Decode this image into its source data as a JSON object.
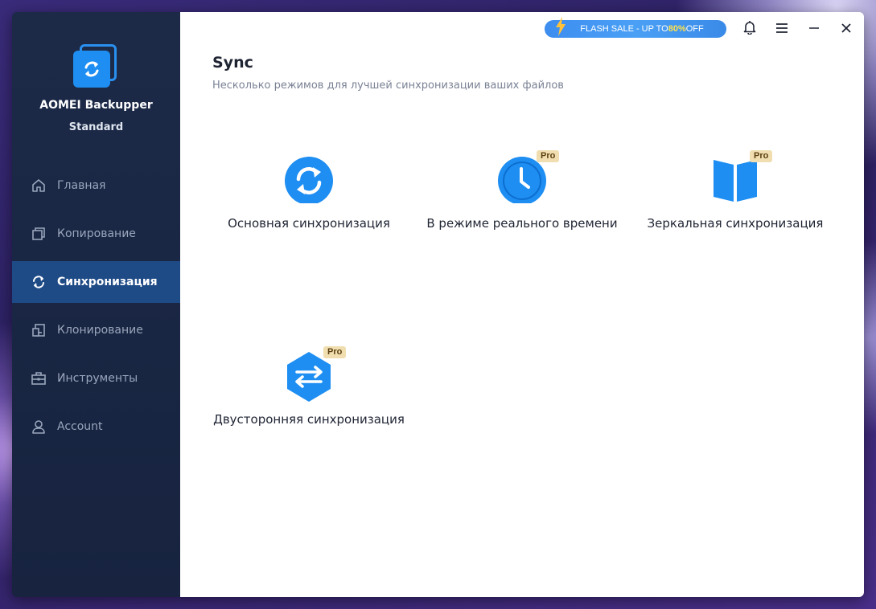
{
  "app": {
    "name": "AOMEI Backupper",
    "edition": "Standard"
  },
  "sidebar": {
    "items": [
      {
        "label": "Главная",
        "icon": "home-icon"
      },
      {
        "label": "Копирование",
        "icon": "copy-icon"
      },
      {
        "label": "Синхронизация",
        "icon": "sync-icon",
        "active": true
      },
      {
        "label": "Клонирование",
        "icon": "clone-icon"
      },
      {
        "label": "Инструменты",
        "icon": "toolbox-icon"
      },
      {
        "label": "Account",
        "icon": "user-icon"
      }
    ]
  },
  "topbar": {
    "flash_text": "FLASH SALE - UP TO ",
    "flash_pct": "80%",
    "flash_tail": " OFF"
  },
  "main": {
    "title": "Sync",
    "subtitle": "Несколько режимов для лучшей синхронизации ваших файлов",
    "pro_badge": "Pro",
    "cards": [
      {
        "label": "Основная синхронизация",
        "icon": "basic-sync-icon",
        "pro": false
      },
      {
        "label": "В режиме реального времени",
        "icon": "clock-icon",
        "pro": true
      },
      {
        "label": "Зеркальная синхронизация",
        "icon": "mirror-icon",
        "pro": true
      },
      {
        "label": "Двусторонняя синхронизация",
        "icon": "two-way-sync-icon",
        "pro": true
      }
    ]
  },
  "colors": {
    "accent": "#1e8ef2",
    "sidebar_bg": "#1c2a48",
    "active_bg": "#1e4a86",
    "pro_bg": "#f1deb0"
  }
}
